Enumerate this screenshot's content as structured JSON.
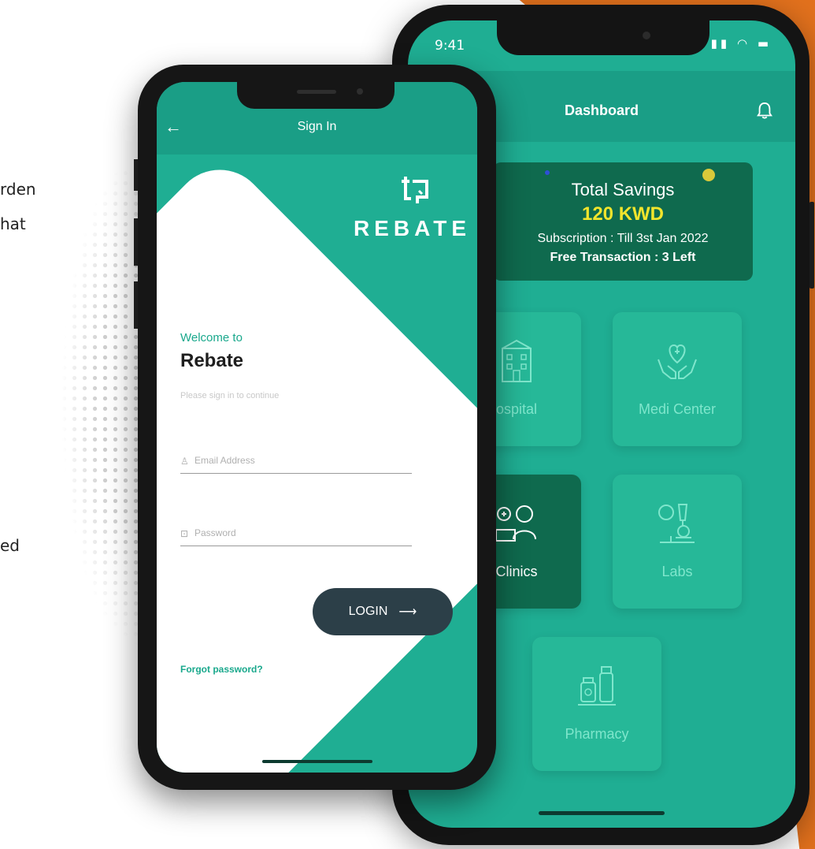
{
  "background": {
    "fragments": [
      "rden",
      "hat",
      "ed"
    ]
  },
  "dashboard": {
    "status": {
      "time": "9:41",
      "signal_icon": "signal-icon",
      "wifi_icon": "wifi-icon",
      "battery_icon": "battery-icon"
    },
    "title": "Dashboard",
    "savings": {
      "title": "Total Savings",
      "amount": "120 KWD",
      "subscription": "Subscription : Till 3st Jan 2022",
      "free_transaction": "Free Transaction : 3 Left"
    },
    "tiles": [
      {
        "label": "ospital",
        "icon": "hospital-icon"
      },
      {
        "label": "Medi Center",
        "icon": "medical-hands-icon"
      },
      {
        "label": "Clinics",
        "icon": "doctor-icon"
      },
      {
        "label": "Labs",
        "icon": "microscope-icon"
      },
      {
        "label": "Pharmacy",
        "icon": "medicine-bottles-icon"
      }
    ],
    "colors": {
      "primary": "#1fae93",
      "header": "#1a9e86",
      "dark": "#0f6a4e",
      "amount": "#f2e52c"
    }
  },
  "signin": {
    "title": "Sign In",
    "logo_text": "REBATE",
    "welcome": "Welcome to",
    "brand": "Rebate",
    "hint": "Please sign in to continue",
    "email_placeholder": "Email Address",
    "password_placeholder": "Password",
    "login_label": "LOGIN",
    "forgot_label": "Forgot password?",
    "colors": {
      "button": "#2c3f48",
      "accent": "#19a88c"
    }
  }
}
